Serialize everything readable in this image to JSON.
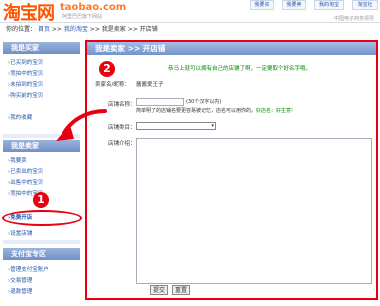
{
  "header": {
    "logo_cn": "淘宝网",
    "logo_en": "taobao.com",
    "logo_sub": "阿里巴巴旗下网站",
    "tagline": "中国电子商务领导",
    "links": [
      "我要买",
      "我要卖",
      "我的淘宝",
      "淘宝社"
    ]
  },
  "breadcrumb": {
    "prefix": "你的位置：",
    "items": [
      "首页",
      "我的淘宝",
      "我是卖家",
      "开店铺"
    ],
    "sep": ">>"
  },
  "sidebar": {
    "buyer": {
      "title": "我是买家",
      "items": [
        "已买到的宝贝",
        "竞拍中的宝贝",
        "未拍到的宝贝",
        "购买前的宝贝",
        "我的收藏"
      ]
    },
    "seller": {
      "title": "我是卖家",
      "items": [
        "我要卖",
        "已卖出的宝贝",
        "出售中的宝贝",
        "竞拍中的宝贝",
        "免费开店",
        "设置店铺"
      ]
    },
    "alipay": {
      "title": "支付宝专区",
      "items": [
        "管理支付宝账户",
        "交易管理",
        "退款管理"
      ]
    }
  },
  "main": {
    "title": "我是卖家 >> 开店铺",
    "note": "恭马上就可以拥有自己的店铺了啊，一定要取个好名字哦。",
    "seller_label": "卖家名/昵称：",
    "seller_value": "酱酱爱王子",
    "shop_name_label": "店铺名称：",
    "shop_name_value": "",
    "shop_name_hint_1": "(30个汉字以内)",
    "shop_name_hint_2": "简单明了的店铺名要更容易被记忆，店名可以用你的。",
    "shop_name_hint_ok": "好店名：好生意!",
    "category_label": "店铺类目：",
    "category_value": "",
    "intro_label": "店铺介绍：",
    "submit_label": "提交",
    "reset_label": "重置"
  },
  "annotations": {
    "step1": "1",
    "step2": "2"
  },
  "colors": {
    "accent": "#e60012",
    "brand": "#ff5500",
    "header_blue": "#7393cb"
  }
}
